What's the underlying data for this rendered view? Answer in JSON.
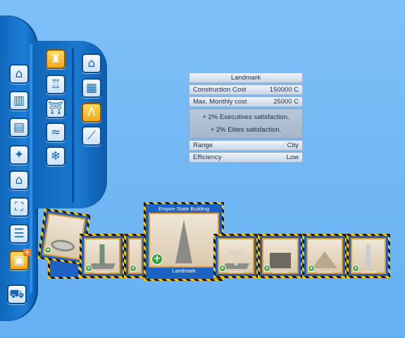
{
  "icons": {
    "main_menu": [
      "house-icon",
      "factory-icon",
      "clipboard-icon",
      "utilities-icon",
      "government-icon",
      "transport-icon",
      "list-icon",
      "gift-icon",
      "bulldozer-icon"
    ],
    "sub_menu_a": [
      "statue-icon",
      "castle-icon",
      "gate-icon",
      "beach-icon",
      "snowflake-icon"
    ],
    "sub_menu_b": [
      "house-icon",
      "office-icon",
      "landmark-icon",
      "road-icon"
    ]
  },
  "info_panel": {
    "title": "Landmark",
    "construction_cost_label": "Construction Cost",
    "construction_cost_value": "150000 C",
    "monthly_cost_label": "Max. Monthly cost",
    "monthly_cost_value": "25000 C",
    "effects": [
      "+ 2% Executives satisfaction.",
      "+ 2% Elites satisfaction."
    ],
    "range_label": "Range",
    "range_value": "City",
    "efficiency_label": "Efficiency",
    "efficiency_value": "Low"
  },
  "carousel": {
    "featured_title": "Empire State Building",
    "featured_caption": "Landmark",
    "card_caption": "Landmark",
    "card_names": [
      "stadium-card",
      "statue-of-liberty-card",
      "partial-card",
      "christ-redeemer-card",
      "cathedral-card",
      "pyramid-card",
      "space-needle-card"
    ]
  },
  "colors": {
    "panel_blue": "#1c62c4",
    "hazard_yellow": "#f4c20d",
    "selected_orange": "#f3a81b",
    "sky": "#6cb4f4"
  }
}
